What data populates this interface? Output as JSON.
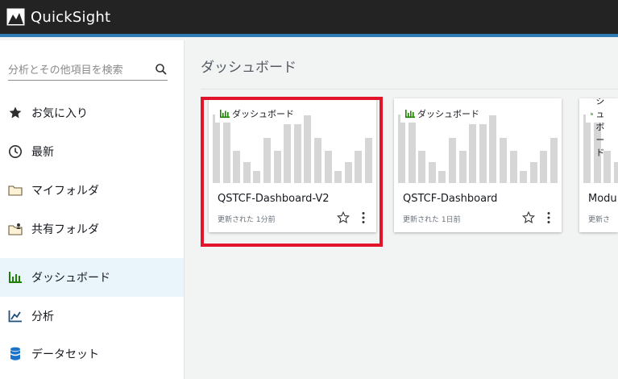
{
  "app": {
    "title": "QuickSight"
  },
  "sidebar": {
    "search": {
      "placeholder": "分析とその他項目を検索",
      "value": ""
    },
    "items": [
      {
        "label": "お気に入り",
        "icon": "star-icon"
      },
      {
        "label": "最新",
        "icon": "clock-icon"
      },
      {
        "label": "マイフォルダ",
        "icon": "folder-icon"
      },
      {
        "label": "共有フォルダ",
        "icon": "shared-folder-icon"
      },
      {
        "label": "ダッシュボード",
        "icon": "dashboard-icon",
        "active": true
      },
      {
        "label": "分析",
        "icon": "analysis-icon"
      },
      {
        "label": "データセット",
        "icon": "dataset-icon"
      }
    ]
  },
  "main": {
    "title": "ダッシュボード",
    "cards": [
      {
        "badge": "ダッシュボード",
        "title": "QSTCF-Dashboard-V2",
        "updated": "更新された 1分前",
        "selected": true
      },
      {
        "badge": "ダッシュボード",
        "title": "QSTCF-Dashboard",
        "updated": "更新された 1日前"
      },
      {
        "badge": "ダッシュボード",
        "title": "Modu",
        "updated": "更新さ"
      }
    ]
  },
  "colors": {
    "topbar": "#232323",
    "accent_line": "#2f7bb5",
    "active_bg": "#e9f4fb",
    "dashboard_icon": "#1d8102",
    "selection": "#e2142b"
  }
}
